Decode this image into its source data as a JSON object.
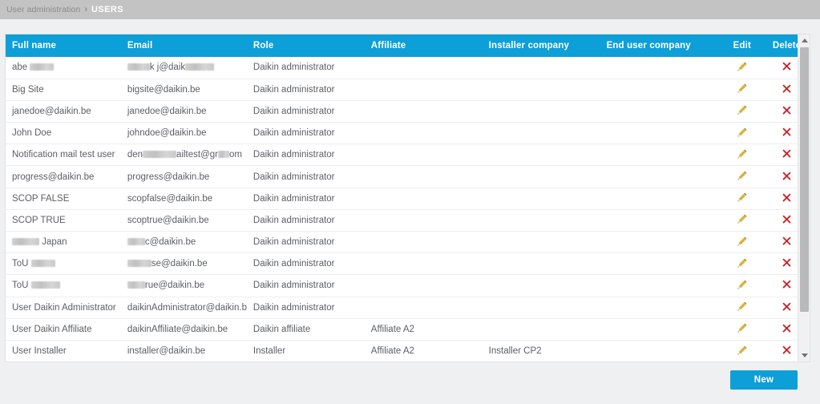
{
  "breadcrumb": {
    "parent": "User administration",
    "separator": "›",
    "current": "USERS"
  },
  "colors": {
    "header_blue": "#0d9fd8",
    "button_blue": "#0d9fd8",
    "delete_red": "#cc2029",
    "edit_yellow": "#c9a227",
    "page_grey": "#c3c3c3",
    "body_grey": "#eef0f2"
  },
  "table": {
    "columns": [
      {
        "key": "full_name",
        "label": "Full name"
      },
      {
        "key": "email",
        "label": "Email"
      },
      {
        "key": "role",
        "label": "Role"
      },
      {
        "key": "affiliate",
        "label": "Affiliate"
      },
      {
        "key": "installer_company",
        "label": "Installer company"
      },
      {
        "key": "end_user_company",
        "label": "End user company"
      },
      {
        "key": "edit",
        "label": "Edit"
      },
      {
        "key": "delete",
        "label": "Delete"
      }
    ],
    "rows": [
      {
        "full_name": "abe",
        "full_name_redacted": true,
        "email": "@daik",
        "email_redacted": true,
        "role": "Daikin administrator",
        "affiliate": "",
        "installer_company": "",
        "end_user_company": ""
      },
      {
        "full_name": "Big Site",
        "email": "bigsite@daikin.be",
        "role": "Daikin administrator",
        "affiliate": "",
        "installer_company": "",
        "end_user_company": ""
      },
      {
        "full_name": "janedoe@daikin.be",
        "email": "janedoe@daikin.be",
        "role": "Daikin administrator",
        "affiliate": "",
        "installer_company": "",
        "end_user_company": ""
      },
      {
        "full_name": "John Doe",
        "email": "johndoe@daikin.be",
        "role": "Daikin administrator",
        "affiliate": "",
        "installer_company": "",
        "end_user_company": ""
      },
      {
        "full_name": "Notification mail test user",
        "email": "den███ailtest@gr██om",
        "email_redacted": true,
        "role": "Daikin administrator",
        "affiliate": "",
        "installer_company": "",
        "end_user_company": ""
      },
      {
        "full_name": "progress@daikin.be",
        "email": "progress@daikin.be",
        "role": "Daikin administrator",
        "affiliate": "",
        "installer_company": "",
        "end_user_company": ""
      },
      {
        "full_name": "SCOP FALSE",
        "email": "scopfalse@daikin.be",
        "role": "Daikin administrator",
        "affiliate": "",
        "installer_company": "",
        "end_user_company": ""
      },
      {
        "full_name": "SCOP TRUE",
        "email": "scoptrue@daikin.be",
        "role": "Daikin administrator",
        "affiliate": "",
        "installer_company": "",
        "end_user_company": ""
      },
      {
        "full_name": "Japan",
        "full_name_redacted": true,
        "email": "c@daikin.be",
        "email_redacted": true,
        "role": "Daikin administrator",
        "affiliate": "",
        "installer_company": "",
        "end_user_company": ""
      },
      {
        "full_name": "ToU",
        "full_name_redacted": true,
        "email": "se@daikin.be",
        "email_redacted": true,
        "role": "Daikin administrator",
        "affiliate": "",
        "installer_company": "",
        "end_user_company": ""
      },
      {
        "full_name": "ToU TRUE",
        "full_name_redacted": true,
        "email": "rue@daikin.be",
        "email_redacted": true,
        "role": "Daikin administrator",
        "affiliate": "",
        "installer_company": "",
        "end_user_company": ""
      },
      {
        "full_name": "User Daikin Administrator",
        "email": "daikinAdministrator@daikin.be",
        "role": "Daikin administrator",
        "affiliate": "",
        "installer_company": "",
        "end_user_company": ""
      },
      {
        "full_name": "User Daikin Affiliate",
        "email": "daikinAffiliate@daikin.be",
        "role": "Daikin affiliate",
        "affiliate": "Affiliate A2",
        "installer_company": "",
        "end_user_company": ""
      },
      {
        "full_name": "User Installer",
        "email": "installer@daikin.be",
        "role": "Installer",
        "affiliate": "Affiliate A2",
        "installer_company": "Installer CP2",
        "end_user_company": ""
      }
    ]
  },
  "icons": {
    "edit": "pencil-icon",
    "delete": "x-mark-icon",
    "scroll_up": "chevron-up-icon",
    "scroll_down": "chevron-down-icon"
  },
  "footer": {
    "new_label": "New"
  }
}
